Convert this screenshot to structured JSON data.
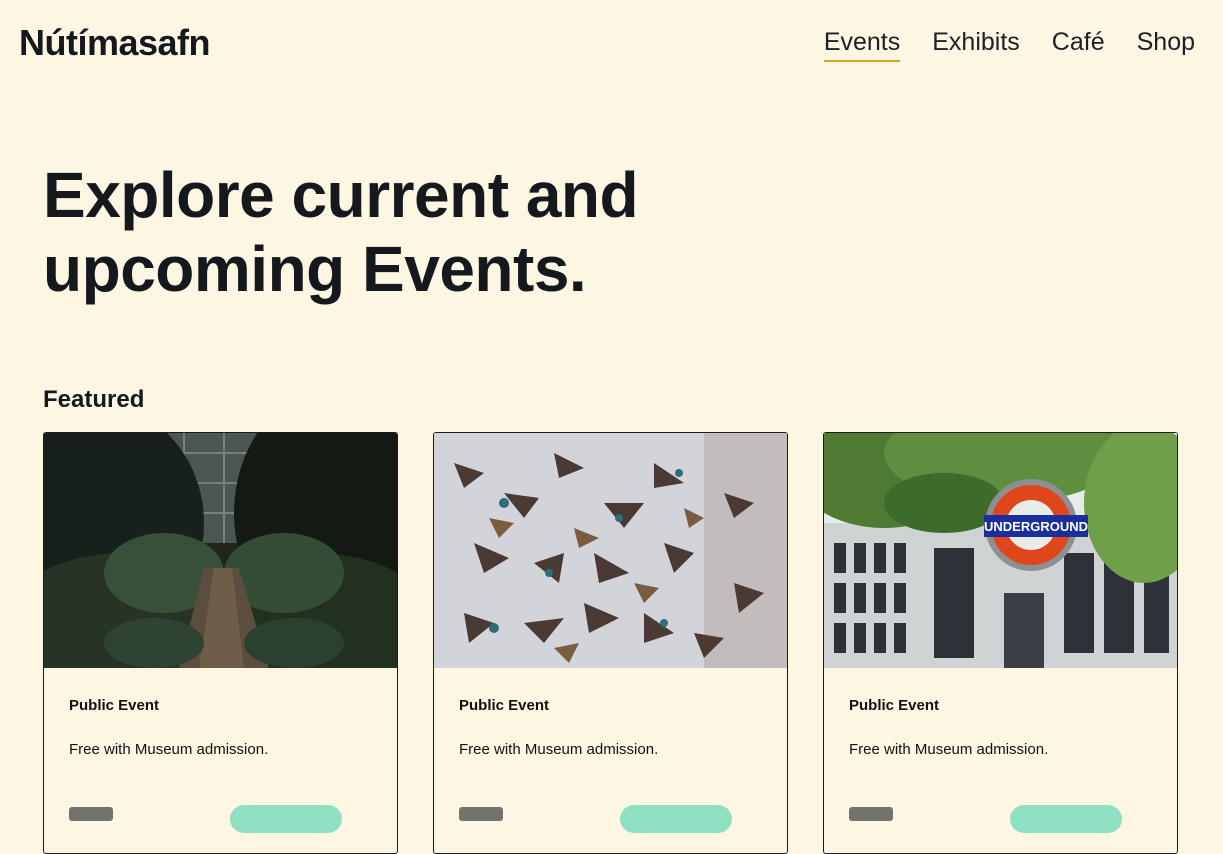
{
  "site": {
    "logo": "Nútímasafn"
  },
  "nav": {
    "items": [
      {
        "label": "Events",
        "active": true
      },
      {
        "label": "Exhibits",
        "active": false
      },
      {
        "label": "Café",
        "active": false
      },
      {
        "label": "Shop",
        "active": false
      }
    ]
  },
  "hero": {
    "title": "Explore current and upcoming Events."
  },
  "featured": {
    "heading": "Featured",
    "cards": [
      {
        "type": "Public Event",
        "description": "Free with Museum admission.",
        "image": "greenhouse-path-photo"
      },
      {
        "type": "Public Event",
        "description": "Free with Museum admission.",
        "image": "hummingbird-specimens-photo"
      },
      {
        "type": "Public Event",
        "description": "Free with Museum admission.",
        "image": "underground-sign-photo"
      }
    ]
  },
  "colors": {
    "background": "#fcf6e2",
    "text": "#15181d",
    "nav_active_underline": "#d8a51f",
    "button_accent": "#8fe0c2"
  }
}
